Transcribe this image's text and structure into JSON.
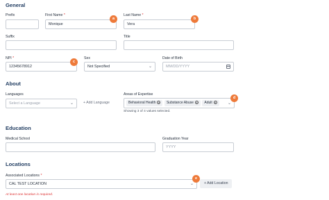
{
  "sections": {
    "general": "General",
    "about": "About",
    "education": "Education",
    "locations": "Locations"
  },
  "general": {
    "prefix_label": "Prefix",
    "prefix_value": "",
    "first_name_label": "First Name",
    "first_name_value": "Monique",
    "last_name_label": "Last Name",
    "last_name_value": "Vera",
    "suffix_label": "Suffix",
    "suffix_value": "",
    "title_label": "Title",
    "title_value": "",
    "npi_label": "NPI",
    "npi_value": "12345678912",
    "sex_label": "Sex",
    "sex_value": "Not Specified",
    "dob_label": "Date of Birth",
    "dob_placeholder": "MM/DD/YYYY",
    "required_mark": "*"
  },
  "about": {
    "languages_label": "Languages",
    "languages_placeholder": "Select a Language",
    "add_language": "+ Add Language",
    "expertise_label": "Areas of Expertise",
    "expertise_tags": [
      "Behavioral Health",
      "Substance Abuse",
      "Adult"
    ],
    "tag_remove_glyph": "×",
    "expertise_hint": "Showing 3 of 4 values selected."
  },
  "education": {
    "school_label": "Medical School",
    "school_value": "",
    "grad_label": "Graduation Year",
    "grad_placeholder": "YYYY"
  },
  "locations": {
    "assoc_label": "Associated Locations",
    "assoc_value": "CAL TEST LOCATION",
    "add_location": "+ Add Location",
    "error": "At least one location is required."
  },
  "markers": [
    "a",
    "b",
    "c",
    "d",
    "e"
  ],
  "icons": {
    "chevron": "chevron-down-icon",
    "calendar": "calendar-icon",
    "remove": "close-circle-icon"
  },
  "colors": {
    "marker": "#ee7a3a",
    "heading": "#1e3a5f",
    "required": "#dd3333"
  }
}
